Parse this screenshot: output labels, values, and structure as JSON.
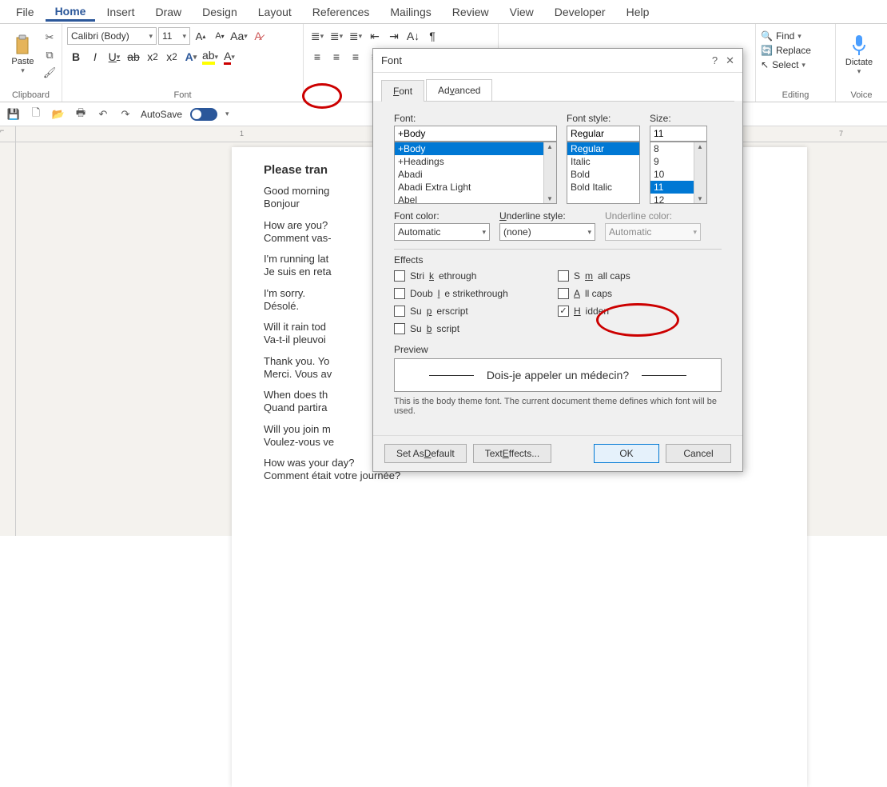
{
  "menubar": [
    "File",
    "Home",
    "Insert",
    "Draw",
    "Design",
    "Layout",
    "References",
    "Mailings",
    "Review",
    "View",
    "Developer",
    "Help"
  ],
  "menubar_active": 1,
  "ribbon": {
    "clipboard": {
      "label": "Clipboard",
      "paste": "Paste"
    },
    "font": {
      "label": "Font",
      "font_name": "Calibri (Body)",
      "font_size": "11",
      "bold": "B",
      "italic": "I",
      "underline": "U",
      "strike": "ab",
      "sub": "x₂",
      "sup": "x²",
      "effects": "A",
      "highlight": "🖉",
      "fontcolor": "A",
      "grow": "A▴",
      "shrink": "A▾",
      "case": "Aa",
      "clear": "🧹"
    },
    "paragraph": {
      "label": " "
    },
    "editing": {
      "label": "Editing",
      "find": "Find",
      "replace": "Replace",
      "select": "Select"
    },
    "voice": {
      "label": "Voice",
      "dictate": "Dictate"
    }
  },
  "qat": {
    "autosave_label": "AutoSave",
    "autosave_on": "On"
  },
  "document": {
    "heading": "Please tran",
    "lines": [
      "Good morning",
      "Bonjour",
      "",
      "How are you?",
      "Comment vas-",
      "",
      "I'm running lat",
      "Je suis en reta",
      "",
      "I'm sorry.",
      "Désolé.",
      "",
      "Will it rain tod",
      "Va-t-il pleuvoi",
      "",
      "Thank you. Yo",
      "Merci. Vous av",
      "",
      "When does th",
      "Quand partira",
      "",
      "Will you join m",
      "Voulez-vous ve",
      "",
      "How was your day?",
      "Comment était votre journée?"
    ]
  },
  "dialog": {
    "title": "Font",
    "tabs": [
      "Font",
      "Advanced"
    ],
    "active_tab": 0,
    "font_label": "Font:",
    "font_value": "+Body",
    "font_list": [
      "+Body",
      "+Headings",
      "Abadi",
      "Abadi Extra Light",
      "Abel"
    ],
    "style_label": "Font style:",
    "style_value": "Regular",
    "style_list": [
      "Regular",
      "Italic",
      "Bold",
      "Bold Italic"
    ],
    "size_label": "Size:",
    "size_value": "11",
    "size_list": [
      "8",
      "9",
      "10",
      "11",
      "12"
    ],
    "font_color_label": "Font color:",
    "font_color_value": "Automatic",
    "underline_style_label": "Underline style:",
    "underline_style_value": "(none)",
    "underline_color_label": "Underline color:",
    "underline_color_value": "Automatic",
    "effects_label": "Effects",
    "effects_left": [
      "Strikethrough",
      "Double strikethrough",
      "Superscript",
      "Subscript"
    ],
    "effects_right": [
      "Small caps",
      "All caps",
      "Hidden"
    ],
    "hidden_checked": true,
    "preview_label": "Preview",
    "preview_text": "Dois-je appeler un médecin?",
    "note": "This is the body theme font. The current document theme defines which font will be used.",
    "btn_default": "Set As Default",
    "btn_texteffects": "Text Effects...",
    "btn_ok": "OK",
    "btn_cancel": "Cancel"
  }
}
